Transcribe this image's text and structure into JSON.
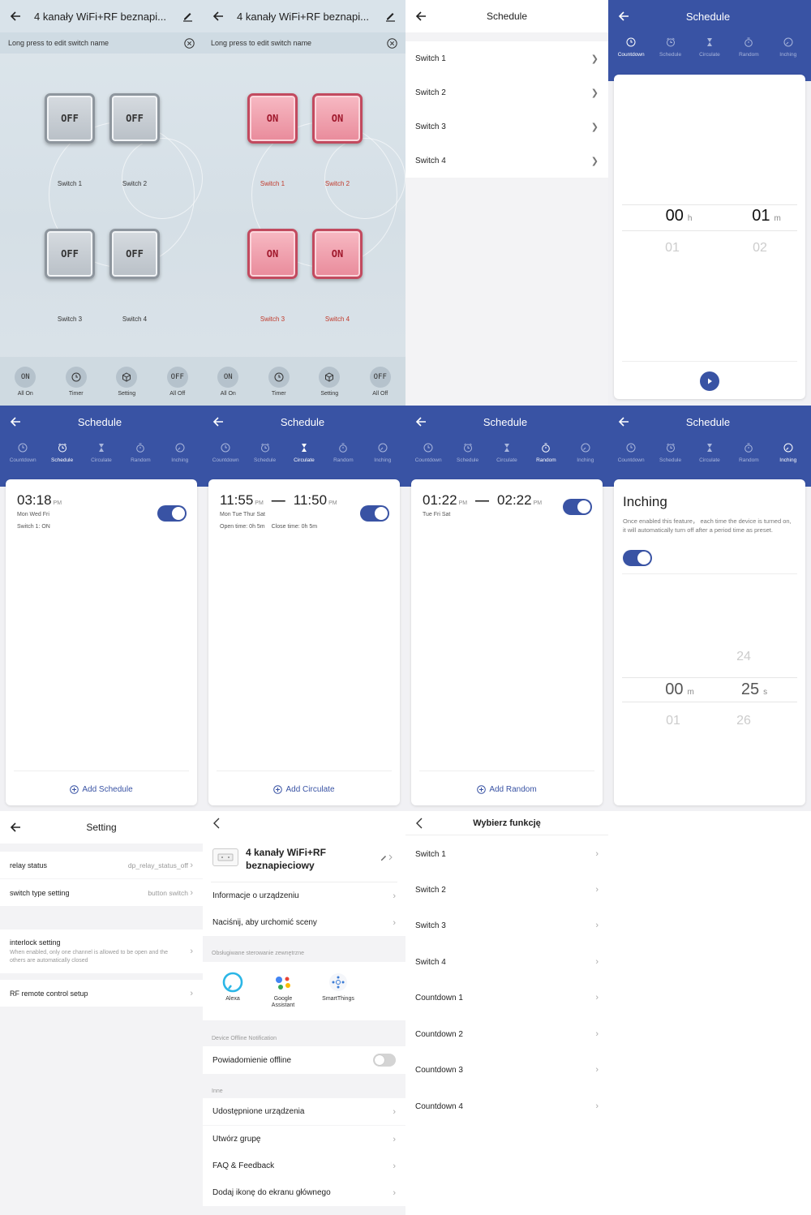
{
  "switch_panel": {
    "title": "4 kanały WiFi+RF beznapi...",
    "hint": "Long press to edit switch name",
    "switches": [
      {
        "label": "Switch 1"
      },
      {
        "label": "Switch 2"
      },
      {
        "label": "Switch 3"
      },
      {
        "label": "Switch 4"
      }
    ],
    "off_text": "OFF",
    "on_text": "ON",
    "bottom": {
      "all_on": "All On",
      "timer": "Timer",
      "setting": "Setting",
      "all_off": "All Off",
      "on_icon": "ON",
      "off_icon": "OFF"
    }
  },
  "schedule_list": {
    "title": "Schedule",
    "items": [
      "Switch 1",
      "Switch 2",
      "Switch 3",
      "Switch 4"
    ]
  },
  "tabs": [
    "Countdown",
    "Schedule",
    "Circulate",
    "Random",
    "Inching"
  ],
  "countdown": {
    "title": "Schedule",
    "hour": "00",
    "hour_unit": "h",
    "min": "01",
    "min_unit": "m",
    "hour_next": "01",
    "min_next": "02"
  },
  "schedule_card": {
    "title": "Schedule",
    "time": "03:18",
    "ampm": "PM",
    "days": "Mon Wed Fri",
    "action": "Switch 1: ON",
    "add": "Add Schedule"
  },
  "circulate_card": {
    "title": "Schedule",
    "start": "11:55",
    "start_ampm": "PM",
    "end": "11:50",
    "end_ampm": "PM",
    "days": "Mon Tue Thur Sat",
    "open": "Open time: 0h 5m",
    "close": "Close time: 0h 5m",
    "add": "Add Circulate"
  },
  "random_card": {
    "title": "Schedule",
    "start": "01:22",
    "start_ampm": "PM",
    "end": "02:22",
    "end_ampm": "PM",
    "days": "Tue Fri Sat",
    "add": "Add Random"
  },
  "inching_card": {
    "title": "Schedule",
    "heading": "Inching",
    "desc": "Once enabled this feature， each time the device is turned on, it will automatically turn off after a period time as preset.",
    "min": "00",
    "min_unit": "m",
    "sec": "25",
    "sec_unit": "s",
    "sec_prev": "24",
    "sec_next": "26",
    "min_next": "01"
  },
  "setting": {
    "title": "Setting",
    "relay_status_label": "relay status",
    "relay_status_value": "dp_relay_status_off",
    "switch_type_label": "switch type setting",
    "switch_type_value": "button switch",
    "interlock_label": "interlock setting",
    "interlock_desc": "When enabled, only one channel is allowed to be open and the others are automatically closed",
    "rf_label": "RF remote control setup"
  },
  "device": {
    "name": "4 kanały WiFi+RF beznapieciowy",
    "info": "Informacje o urządzeniu",
    "scene": "Naciśnij, aby urchomić sceny",
    "ext_section": "Obsługiwane sterowanie zewnętrzne",
    "alexa": "Alexa",
    "google_1": "Google",
    "google_2": "Assistant",
    "smartthings": "SmartThings",
    "offline_section": "Device Offline Notification",
    "offline": "Powiadomienie offline",
    "other_section": "Inne",
    "shared": "Udostępnione urządzenia",
    "group": "Utwórz grupę",
    "faq": "FAQ & Feedback",
    "homescreen": "Dodaj ikonę do ekranu głównego"
  },
  "function_select": {
    "title": "Wybierz funkcję",
    "items": [
      "Switch 1",
      "Switch 2",
      "Switch 3",
      "Switch 4",
      "Countdown 1",
      "Countdown 2",
      "Countdown 3",
      "Countdown 4"
    ]
  },
  "colors": {
    "primary": "#3953a4",
    "on_red": "#c0392b"
  }
}
